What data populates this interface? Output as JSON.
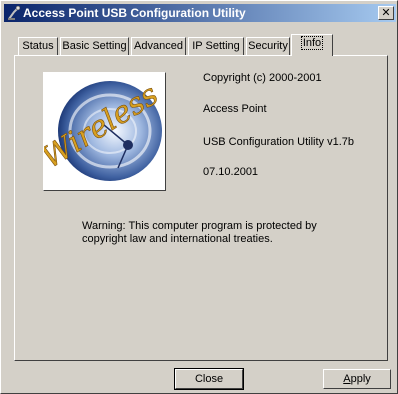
{
  "window": {
    "title": "Access Point USB Configuration Utility",
    "close_glyph": "✕",
    "app_icon": "wireless-app-icon"
  },
  "tabs": [
    {
      "label": "Status",
      "active": false
    },
    {
      "label": "Basic Setting",
      "active": false
    },
    {
      "label": "Advanced",
      "active": false
    },
    {
      "label": "IP Setting",
      "active": false
    },
    {
      "label": "Security",
      "active": false
    },
    {
      "label": "Info",
      "active": true
    }
  ],
  "info": {
    "logo_text": "Wireless",
    "copyright": "Copyright (c) 2000-2001",
    "product": "Access Point",
    "version": "USB Configuration Utility v1.7b",
    "date": "07.10.2001",
    "warning_line1": "Warning: This computer program is protected by",
    "warning_line2": "copyright law and international treaties."
  },
  "buttons": {
    "close": "Close",
    "apply_mnemonic": "A",
    "apply_rest": "pply"
  },
  "colors": {
    "title_start": "#0a246a",
    "title_end": "#a6caf0",
    "face": "#d4d0c8",
    "logo_text": "#d8a020"
  }
}
